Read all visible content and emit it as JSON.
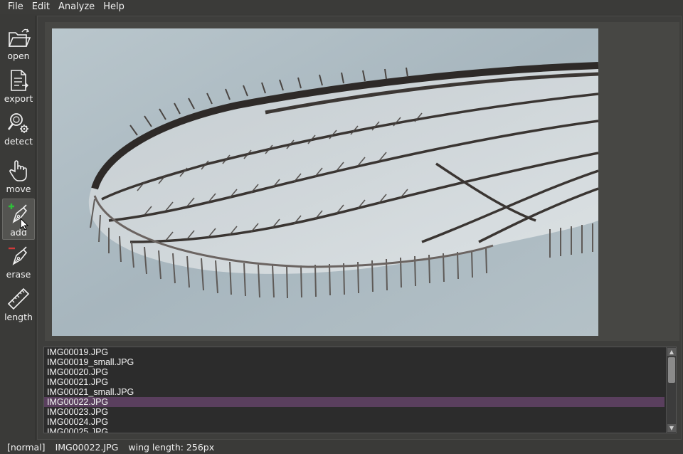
{
  "menubar": {
    "items": [
      "File",
      "Edit",
      "Analyze",
      "Help"
    ]
  },
  "toolbar": {
    "tools": [
      {
        "label": "open",
        "icon": "folder-open-icon"
      },
      {
        "label": "export",
        "icon": "document-export-icon"
      },
      {
        "label": "detect",
        "icon": "magnifier-gear-icon"
      },
      {
        "label": "move",
        "icon": "hand-pointer-icon"
      },
      {
        "label": "add",
        "icon": "pen-plus-icon",
        "active": true
      },
      {
        "label": "erase",
        "icon": "pen-minus-icon"
      },
      {
        "label": "length",
        "icon": "ruler-icon"
      }
    ]
  },
  "image": {
    "subject": "mosquito-wing-micrograph"
  },
  "filelist": {
    "files": [
      "IMG00019.JPG",
      "IMG00019_small.JPG",
      "IMG00020.JPG",
      "IMG00021.JPG",
      "IMG00021_small.JPG",
      "IMG00022.JPG",
      "IMG00023.JPG",
      "IMG00024.JPG",
      "IMG00025.JPG"
    ],
    "selected_index": 5
  },
  "statusbar": {
    "mode": "[normal]",
    "filename": "IMG00022.JPG",
    "measurement": "wing length: 256px"
  },
  "colors": {
    "background": "#3a3a38",
    "selection": "#5a3f5e",
    "add_accent": "#2fbf3a",
    "erase_accent": "#d23a3a"
  }
}
